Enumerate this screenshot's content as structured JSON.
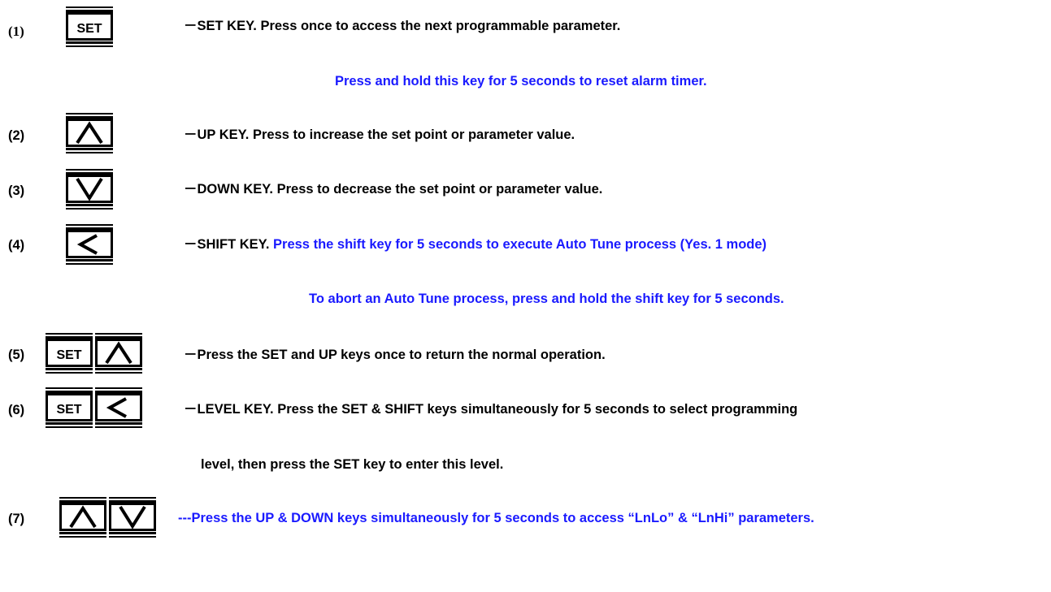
{
  "accent_blue": "#1a1aff",
  "items": [
    {
      "number": "(1)",
      "keys": [
        "set-key"
      ],
      "prefix": "－",
      "line1_black": "SET KEY. Press once to access the next programmable parameter.",
      "line1_blue": "",
      "line2": "Press and hold this key for 5 seconds to reset alarm timer."
    },
    {
      "number": "(2)",
      "keys": [
        "up-arrow-key"
      ],
      "prefix": "－",
      "line1_black": "UP KEY. Press to increase the set point or parameter value."
    },
    {
      "number": "(3)",
      "keys": [
        "down-arrow-key"
      ],
      "prefix": "－",
      "line1_black": "DOWN KEY. Press to decrease the set point or parameter value."
    },
    {
      "number": "(4)",
      "keys": [
        "shift-left-arrow-key"
      ],
      "prefix": "－",
      "line1_black": "SHIFT KEY.",
      "line1_blue": "Press the shift key for 5 seconds to execute Auto Tune process (Yes. 1 mode)",
      "line2": "To abort an Auto Tune process, press and hold the shift key for 5 seconds."
    },
    {
      "number": "(5)",
      "keys": [
        "set-key",
        "up-arrow-key"
      ],
      "prefix": "－",
      "line1_black": "Press the SET and UP keys once to return the normal operation."
    },
    {
      "number": "(6)",
      "keys": [
        "set-key",
        "shift-left-arrow-key"
      ],
      "prefix": "－",
      "line1_black": "LEVEL KEY. Press the SET & SHIFT keys simultaneously for 5 seconds to select programming",
      "line2": "level, then press the SET key to enter this level."
    },
    {
      "number": "(7)",
      "keys": [
        "up-arrow-key",
        "down-arrow-key"
      ],
      "prefix": "",
      "line1_blue": "---Press the UP & DOWN keys simultaneously for 5 seconds to access “LnLo” & “LnHi” parameters."
    }
  ],
  "set_key_label": "SET"
}
